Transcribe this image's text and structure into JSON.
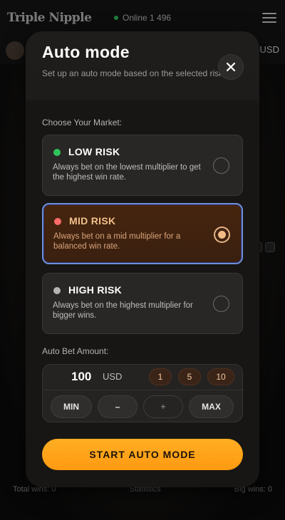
{
  "background": {
    "logo": "Triple Nipple",
    "online_text": "Online 1 496",
    "currency": "USD",
    "stats": [
      "Total wins: 0",
      "Statistics",
      "Big wins: 0"
    ]
  },
  "modal": {
    "title": "Auto mode",
    "subtitle": "Set up an auto mode based on the selected risk",
    "market_label": "Choose Your Market:",
    "risks": [
      {
        "name": "LOW RISK",
        "desc": "Always bet on the lowest multiplier to get the highest win rate.",
        "dot_color": "#2fc45a",
        "selected": false
      },
      {
        "name": "MID RISK",
        "desc": "Always bet on a mid multiplier for a balanced win rate.",
        "dot_color": "#ff6b6b",
        "selected": true
      },
      {
        "name": "HIGH RISK",
        "desc": "Always bet on the highest multiplier for bigger wins.",
        "dot_color": "#b5b5b5",
        "selected": false
      }
    ],
    "amount_label": "Auto Bet Amount:",
    "amount": {
      "value": "100",
      "currency": "USD",
      "chips": [
        "1",
        "5",
        "10"
      ],
      "min_label": "MIN",
      "minus_label": "–",
      "plus_label": "+",
      "max_label": "MAX"
    },
    "start_label": "START AUTO MODE"
  },
  "colors": {
    "accent": "#ff9f1a",
    "selected_border": "#6d8fd8"
  }
}
